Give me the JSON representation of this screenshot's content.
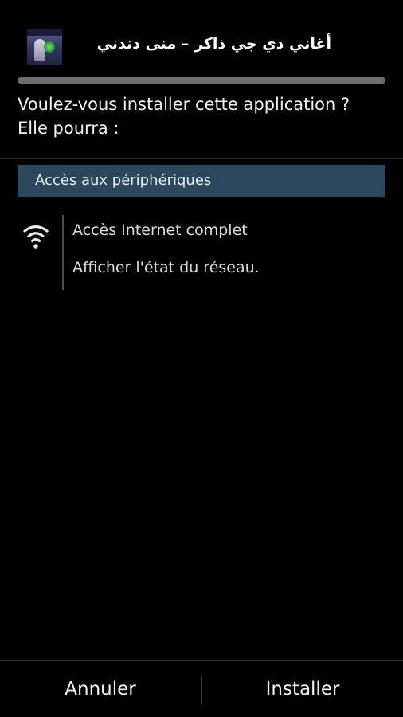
{
  "header": {
    "app_name": "أغاني دي جي ذاكر – منى دندني",
    "app_icon": "app-icon"
  },
  "prompt": {
    "line1": "Voulez-vous installer cette application ?",
    "line2": "Elle pourra :"
  },
  "permissions": {
    "category": "Accès aux périphériques",
    "group_icon": "wifi-icon",
    "items": [
      "Accès Internet complet",
      "Afficher l'état du réseau."
    ]
  },
  "actions": {
    "cancel_label": "Annuler",
    "install_label": "Installer"
  },
  "colors": {
    "background": "#000000",
    "category_bar": "#2a475c",
    "text": "#ededed"
  }
}
